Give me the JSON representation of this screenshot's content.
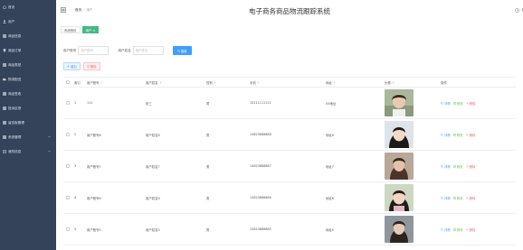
{
  "header": {
    "title": "电子商务商品物流跟踪系统",
    "breadcrumb": {
      "home": "首页",
      "current": "用户"
    },
    "exit_label": "退"
  },
  "sidebar": {
    "items": [
      {
        "label": "首页",
        "icon": "home-icon"
      },
      {
        "label": "用户",
        "icon": "user-icon"
      },
      {
        "label": "商品信息",
        "icon": "grid-icon"
      },
      {
        "label": "商品订单",
        "icon": "pin-icon"
      },
      {
        "label": "商品类型",
        "icon": "grid-icon"
      },
      {
        "label": "物流配送",
        "icon": "truck-icon"
      },
      {
        "label": "商品签收",
        "icon": "grid-icon"
      },
      {
        "label": "投诉反馈",
        "icon": "grid-icon"
      },
      {
        "label": "留言板管理",
        "icon": "grid-icon"
      },
      {
        "label": "系统管理",
        "icon": "grid-icon",
        "has_arrow": true
      },
      {
        "label": "我的信息",
        "icon": "doc-icon",
        "has_arrow": true
      }
    ]
  },
  "tabs": [
    {
      "label": "系统首页",
      "active": false
    },
    {
      "label": "用户 ×",
      "active": true
    }
  ],
  "search": {
    "account_label": "用户账号",
    "account_placeholder": "用户账号",
    "name_label": "用户姓名",
    "name_placeholder": "用户姓名",
    "button_label": "搜索"
  },
  "actions": {
    "add_label": "增加",
    "delete_label": "删除"
  },
  "table": {
    "headers": {
      "no": "索引",
      "account": "用户账号",
      "name": "用户姓名",
      "sex": "性别",
      "phone": "手机",
      "address": "地址",
      "avatar": "头像",
      "ops": "操作"
    },
    "op_labels": {
      "view": "详情",
      "edit": "修改",
      "delete": "删除"
    },
    "rows": [
      {
        "no": "1",
        "account": "111",
        "name": "张三",
        "sex": "男",
        "phone": "13111111111",
        "address": "XX地址"
      },
      {
        "no": "2",
        "account": "用户账号8",
        "name": "用户姓名8",
        "sex": "男",
        "phone": "13823888888",
        "address": "地址8"
      },
      {
        "no": "3",
        "account": "用户账号7",
        "name": "用户姓名7",
        "sex": "男",
        "phone": "13823888887",
        "address": "地址7"
      },
      {
        "no": "4",
        "account": "用户账号6",
        "name": "用户姓名6",
        "sex": "男",
        "phone": "13823888886",
        "address": "地址6"
      },
      {
        "no": "5",
        "account": "用户账号5",
        "name": "用户姓名5",
        "sex": "男",
        "phone": "13823888885",
        "address": "地址5"
      }
    ]
  },
  "colors": {
    "sidebar_bg": "#34425a",
    "primary": "#409eff",
    "tab_active": "#42b983",
    "danger": "#f56c6c",
    "success": "#67c23a"
  }
}
